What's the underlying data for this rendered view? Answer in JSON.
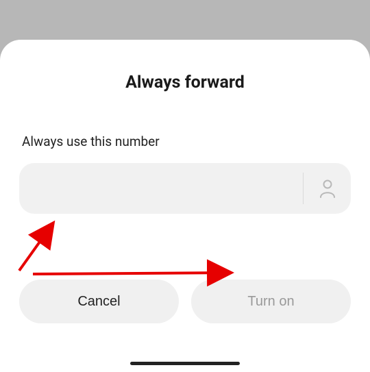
{
  "dialog": {
    "title": "Always forward",
    "field_label": "Always use this number",
    "input_value": "",
    "input_placeholder": "",
    "icons": {
      "contact": "contact-icon"
    },
    "actions": {
      "cancel_label": "Cancel",
      "confirm_label": "Turn on"
    }
  },
  "annotations": {
    "arrow_color": "#e60000"
  }
}
